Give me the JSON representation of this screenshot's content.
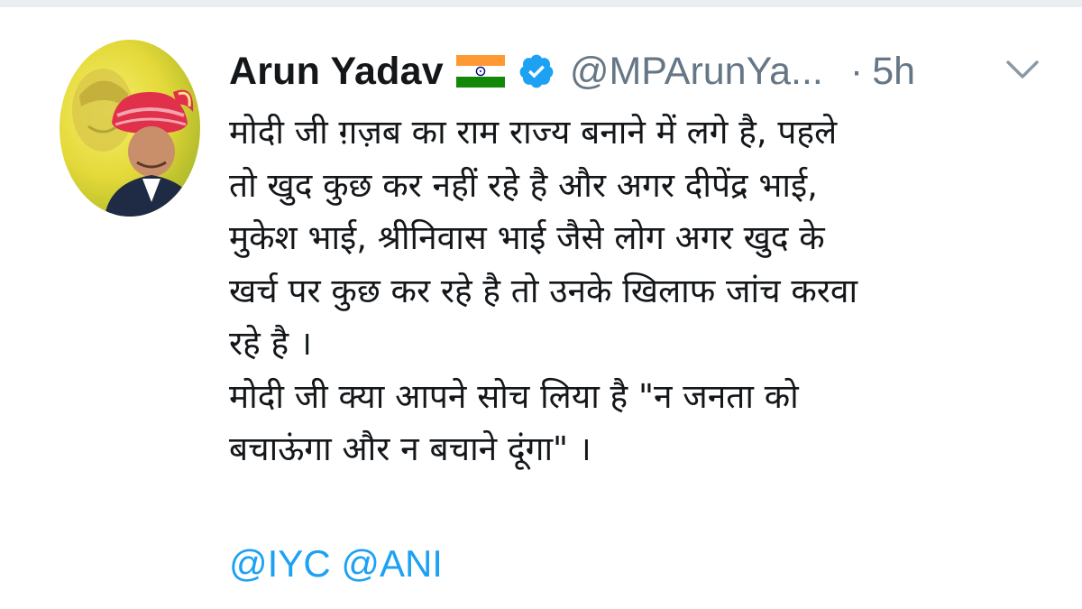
{
  "tweet": {
    "author": {
      "display_name": "Arun Yadav",
      "handle": "@MPArunYa...",
      "flag_icon": "india-flag-icon",
      "verified_icon": "verified-badge-icon"
    },
    "separator": "·",
    "timestamp": "5h",
    "menu_icon": "chevron-down-icon",
    "body_lines": [
      "मोदी जी ग़ज़ब का राम राज्य बनाने में लगे है, पहले",
      "तो खुद कुछ कर नहीं रहे है और अगर दीपेंद्र भाई,",
      "मुकेश भाई, श्रीनिवास भाई जैसे लोग अगर खुद के",
      "खर्च पर कुछ कर रहे है तो उनके खिलाफ जांच करवा",
      "रहे है ।",
      "मोदी जी क्या आपने सोच लिया है \"न जनता को",
      "बचाऊंगा और न बचाने दूंगा\" ।"
    ],
    "mentions": [
      "@IYC",
      "@ANI"
    ],
    "colors": {
      "text": "#14171a",
      "secondary": "#657786",
      "link": "#1da1f2",
      "verified": "#1da1f2",
      "flag_saffron": "#ff9933",
      "flag_green": "#138808",
      "flag_chakra": "#000080"
    }
  }
}
